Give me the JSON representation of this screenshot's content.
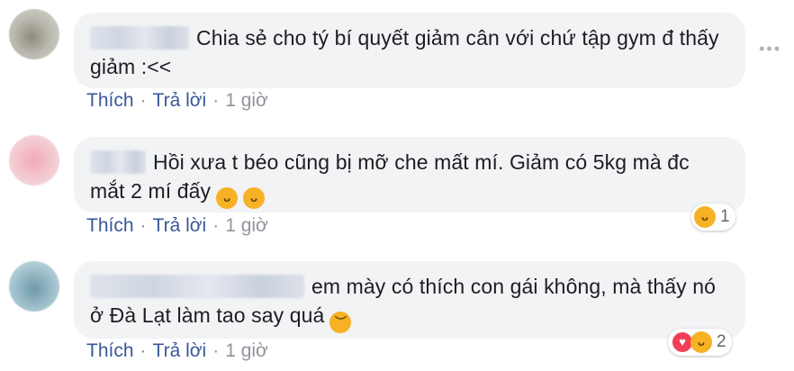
{
  "comments": [
    {
      "text": "Chia sẻ cho tý bí quyết giảm cân với chứ tập gym đ thấy giảm :<<",
      "like": "Thích",
      "reply": "Trả lời",
      "time": "1 giờ",
      "avatar_color": "#a8a9a0"
    },
    {
      "text": "Hồi xưa t béo cũng bị mỡ che mất mí. Giảm có 5kg mà đc mắt 2 mí đấy",
      "like": "Thích",
      "reply": "Trả lời",
      "time": "1 giờ",
      "reaction_count": "1",
      "avatar_color": "#e8b7c0"
    },
    {
      "text": "em mày có thích con gái không, mà thấy nó ở Đà Lạt làm tao say quá",
      "like": "Thích",
      "reply": "Trả lời",
      "time": "1 giờ",
      "reaction_count": "2",
      "avatar_color": "#8fb4c2"
    }
  ],
  "separator": "·",
  "icons": {
    "more": "more-options-icon",
    "haha": "haha-reaction-icon",
    "love": "love-reaction-icon",
    "sad": "sad-emoji-icon"
  }
}
